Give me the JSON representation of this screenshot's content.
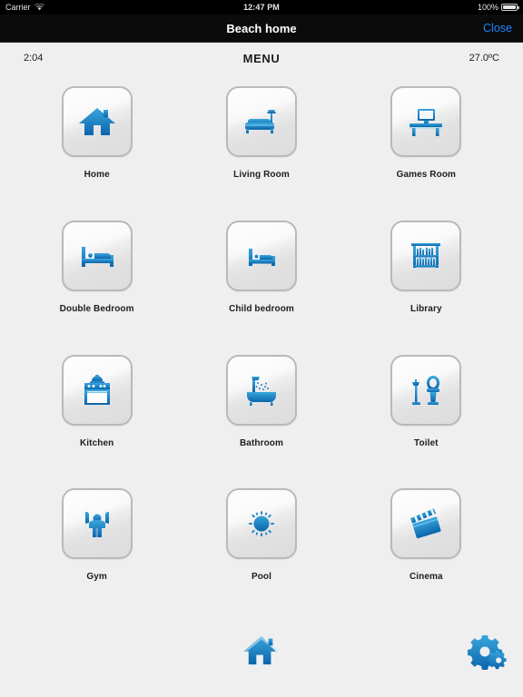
{
  "status_bar": {
    "carrier": "Carrier",
    "wifi_icon": "wifi-icon",
    "time": "12:47 PM",
    "battery_percent": "100%",
    "battery_icon": "battery-full-icon"
  },
  "nav_bar": {
    "title": "Beach home",
    "close_label": "Close"
  },
  "info_bar": {
    "time": "2:04",
    "title": "MENU",
    "temperature": "27.0ºC"
  },
  "grid": {
    "items": [
      {
        "label": "Home",
        "icon": "house-icon"
      },
      {
        "label": "Living Room",
        "icon": "sofa-lamp-icon"
      },
      {
        "label": "Games Room",
        "icon": "desk-monitor-icon"
      },
      {
        "label": "Double Bedroom",
        "icon": "double-bed-icon"
      },
      {
        "label": "Child bedroom",
        "icon": "child-bed-icon"
      },
      {
        "label": "Library",
        "icon": "bookshelf-icon"
      },
      {
        "label": "Kitchen",
        "icon": "oven-pot-icon"
      },
      {
        "label": "Bathroom",
        "icon": "bathtub-shower-icon"
      },
      {
        "label": "Toilet",
        "icon": "sink-toilet-icon"
      },
      {
        "label": "Gym",
        "icon": "person-arms-up-icon"
      },
      {
        "label": "Pool",
        "icon": "sun-icon"
      },
      {
        "label": "Cinema",
        "icon": "clapperboard-icon"
      }
    ]
  },
  "toolbar": {
    "home_icon": "house-icon",
    "settings_icon": "gears-icon"
  },
  "colors": {
    "accent_blue": "#1a7fc1",
    "icon_blue_dark": "#0c6ab0",
    "icon_blue_light": "#34a4db",
    "link_blue": "#1d86ff",
    "page_bg": "#efeff0",
    "tile_border": "#b9b9ba",
    "navbar_bg": "#0b0b0b",
    "text_dark": "#1d1d1d"
  }
}
